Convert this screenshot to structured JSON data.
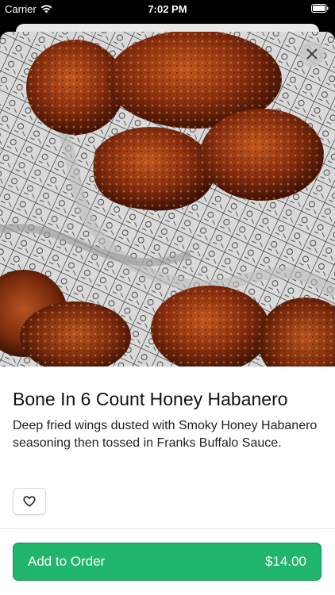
{
  "status_bar": {
    "carrier": "Carrier",
    "time": "7:02 PM"
  },
  "item": {
    "title": "Bone In 6 Count Honey Habanero",
    "description": "Deep fried wings dusted with Smoky Honey Habanero seasoning then tossed in Franks Buffalo Sauce."
  },
  "order_button": {
    "label": "Add to Order",
    "price": "$14.00"
  },
  "icons": {
    "close": "close-icon",
    "favorite": "heart-icon",
    "wifi": "wifi-icon",
    "battery": "battery-icon"
  },
  "colors": {
    "accent": "#1fb56a",
    "accent_border": "#14894f"
  }
}
